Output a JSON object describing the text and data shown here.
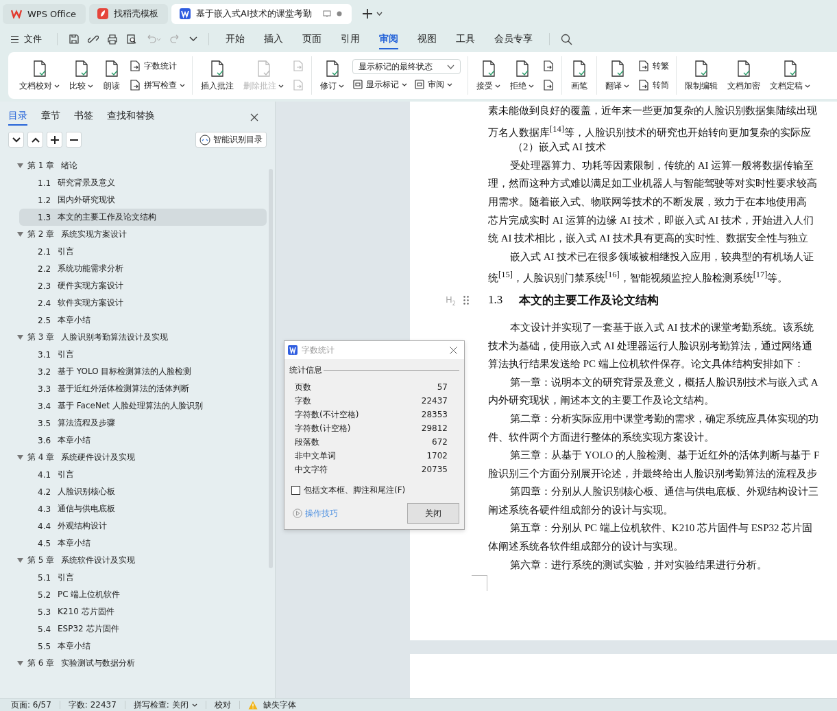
{
  "browser_tabs": [
    {
      "label": "WPS Office",
      "selected": false
    },
    {
      "label": "找稻壳模板",
      "selected": false
    },
    {
      "label": "基于嵌入式AI技术的课堂考勤",
      "selected": true
    }
  ],
  "menu": {
    "file": "文件",
    "tabs": [
      {
        "label": "开始",
        "selected": false
      },
      {
        "label": "插入",
        "selected": false
      },
      {
        "label": "页面",
        "selected": false
      },
      {
        "label": "引用",
        "selected": false
      },
      {
        "label": "审阅",
        "selected": true
      },
      {
        "label": "视图",
        "selected": false
      },
      {
        "label": "工具",
        "selected": false
      },
      {
        "label": "会员专享",
        "selected": false
      }
    ]
  },
  "ribbon": {
    "groups": [
      {
        "items": [
          {
            "kind": "large",
            "label": "文档校对",
            "caret": true,
            "disabled": false
          },
          {
            "kind": "large",
            "label": "比较",
            "caret": true,
            "disabled": false
          },
          {
            "kind": "large",
            "label": "朗读",
            "caret": false,
            "disabled": false
          },
          {
            "kind": "stack",
            "rows": [
              {
                "label": "字数统计",
                "caret": false,
                "disabled": false
              },
              {
                "label": "拼写检查",
                "caret": true,
                "disabled": false
              }
            ]
          }
        ]
      },
      {
        "items": [
          {
            "kind": "large",
            "label": "插入批注",
            "caret": false,
            "disabled": false
          },
          {
            "kind": "large",
            "label": "删除批注",
            "caret": true,
            "disabled": true
          },
          {
            "kind": "stack",
            "rows": [
              {
                "caret": false,
                "disabled": true
              },
              {
                "caret": false,
                "disabled": true
              }
            ]
          }
        ]
      },
      {
        "items": [
          {
            "kind": "large",
            "label": "修订",
            "caret": true,
            "disabled": false
          },
          {
            "kind": "combo",
            "value": "显示标记的最终状态",
            "buttons": [
              {
                "label": "显示标记",
                "caret": true
              },
              {
                "label": "审阅",
                "caret": true
              }
            ]
          }
        ]
      },
      {
        "items": [
          {
            "kind": "large",
            "label": "接受",
            "caret": true,
            "disabled": false
          },
          {
            "kind": "large",
            "label": "拒绝",
            "caret": true,
            "disabled": false
          },
          {
            "kind": "stack",
            "rows": [
              {
                "caret": false,
                "disabled": false
              },
              {
                "caret": false,
                "disabled": false
              }
            ]
          }
        ]
      },
      {
        "items": [
          {
            "kind": "large",
            "label": "画笔",
            "caret": false,
            "disabled": false
          }
        ]
      },
      {
        "items": [
          {
            "kind": "large",
            "label": "翻译",
            "caret": true,
            "disabled": false
          },
          {
            "kind": "stack",
            "rows": [
              {
                "label": "转繁",
                "caret": false,
                "disabled": false
              },
              {
                "label": "转简",
                "caret": false,
                "disabled": false
              }
            ]
          }
        ]
      },
      {
        "items": [
          {
            "kind": "large",
            "label": "限制编辑",
            "caret": false,
            "disabled": false
          },
          {
            "kind": "large",
            "label": "文档加密",
            "caret": false,
            "disabled": false
          },
          {
            "kind": "large",
            "label": "文档定稿",
            "caret": true,
            "disabled": false
          }
        ]
      }
    ]
  },
  "sidebar": {
    "tabs": [
      {
        "label": "目录",
        "selected": true
      },
      {
        "label": "章节",
        "selected": false
      },
      {
        "label": "书签",
        "selected": false
      },
      {
        "label": "查找和替换",
        "selected": false
      }
    ],
    "smart_button": "智能识别目录",
    "chapters": [
      {
        "number": "第 1 章",
        "title": "绪论",
        "expanded": true,
        "children": [
          {
            "number": "1.1",
            "title": "研究背景及意义",
            "selected": false
          },
          {
            "number": "1.2",
            "title": "国内外研究现状",
            "selected": false
          },
          {
            "number": "1.3",
            "title": "本文的主要工作及论文结构",
            "selected": true
          }
        ]
      },
      {
        "number": "第 2 章",
        "title": "系统实现方案设计",
        "expanded": true,
        "children": [
          {
            "number": "2.1",
            "title": "引言",
            "selected": false
          },
          {
            "number": "2.2",
            "title": "系统功能需求分析",
            "selected": false
          },
          {
            "number": "2.3",
            "title": "硬件实现方案设计",
            "selected": false
          },
          {
            "number": "2.4",
            "title": "软件实现方案设计",
            "selected": false
          },
          {
            "number": "2.5",
            "title": "本章小结",
            "selected": false
          }
        ]
      },
      {
        "number": "第 3 章",
        "title": "人脸识别考勤算法设计及实现",
        "expanded": true,
        "children": [
          {
            "number": "3.1",
            "title": "引言",
            "selected": false
          },
          {
            "number": "3.2",
            "title": "基于 YOLO 目标检测算法的人脸检测",
            "selected": false
          },
          {
            "number": "3.3",
            "title": "基于近红外活体检测算法的活体判断",
            "selected": false
          },
          {
            "number": "3.4",
            "title": "基于 FaceNet 人脸处理算法的人脸识别",
            "selected": false
          },
          {
            "number": "3.5",
            "title": "算法流程及步骤",
            "selected": false
          },
          {
            "number": "3.6",
            "title": "本章小结",
            "selected": false
          }
        ]
      },
      {
        "number": "第 4 章",
        "title": "系统硬件设计及实现",
        "expanded": true,
        "children": [
          {
            "number": "4.1",
            "title": "引言",
            "selected": false
          },
          {
            "number": "4.2",
            "title": "人脸识别核心板",
            "selected": false
          },
          {
            "number": "4.3",
            "title": "通信与供电底板",
            "selected": false
          },
          {
            "number": "4.4",
            "title": "外观结构设计",
            "selected": false
          },
          {
            "number": "4.5",
            "title": "本章小结",
            "selected": false
          }
        ]
      },
      {
        "number": "第 5 章",
        "title": "系统软件设计及实现",
        "expanded": true,
        "children": [
          {
            "number": "5.1",
            "title": "引言",
            "selected": false
          },
          {
            "number": "5.2",
            "title": "PC 端上位机软件",
            "selected": false
          },
          {
            "number": "5.3",
            "title": "K210 芯片固件",
            "selected": false
          },
          {
            "number": "5.4",
            "title": "ESP32 芯片固件",
            "selected": false
          },
          {
            "number": "5.5",
            "title": "本章小结",
            "selected": false
          }
        ]
      },
      {
        "number": "第 6 章",
        "title": "实验测试与数据分析",
        "expanded": true
      }
    ]
  },
  "document": {
    "blocks": [
      {
        "kind": "line",
        "indent": false,
        "text": "素未能做到良好的覆盖，近年来一些更加复杂的人脸识别数据集陆续出现"
      },
      {
        "kind": "line",
        "indent": false,
        "text": "万名人数据库$^{[14]}$等，人脸识别技术的研究也开始转向更加复杂的实际应"
      },
      {
        "kind": "sub",
        "indent": true,
        "text": "（2）嵌入式 AI 技术"
      },
      {
        "kind": "line",
        "indent": true,
        "text": "受处理器算力、功耗等因素限制，传统的 AI 运算一般将数据传输至"
      },
      {
        "kind": "line",
        "indent": false,
        "text": "理，然而这种方式难以满足如工业机器人与智能驾驶等对实时性要求较高"
      },
      {
        "kind": "line",
        "indent": false,
        "text": "用需求。随着嵌入式、物联网等技术的不断发展，致力于在本地使用高"
      },
      {
        "kind": "line",
        "indent": false,
        "text": "芯片完成实时 AI 运算的边缘 AI 技术，即嵌入式 AI 技术，开始进入人们"
      },
      {
        "kind": "line",
        "indent": false,
        "text": "统 AI 技术相比，嵌入式 AI 技术具有更高的实时性、数据安全性与独立"
      },
      {
        "kind": "line",
        "indent": true,
        "text": "嵌入式 AI 技术已在很多领域被相继投入应用，较典型的有机场人证"
      },
      {
        "kind": "line",
        "indent": false,
        "text": "统$^{[15]}$，人脸识别门禁系统$^{[16]}$，智能视频监控人脸检测系统$^{[17]}$等。"
      },
      {
        "kind": "heading",
        "marker": "H$_{2}$",
        "number": "1.3",
        "text": "本文的主要工作及论文结构"
      },
      {
        "kind": "line",
        "indent": true,
        "text": "本文设计并实现了一套基于嵌入式 AI 技术的课堂考勤系统。该系统"
      },
      {
        "kind": "line",
        "indent": false,
        "text": "技术为基础，使用嵌入式 AI 处理器运行人脸识别考勤算法，通过网络通"
      },
      {
        "kind": "line",
        "indent": false,
        "text": "算法执行结果发送给 PC 端上位机软件保存。论文具体结构安排如下："
      },
      {
        "kind": "line",
        "indent": true,
        "text": "第一章：说明本文的研究背景及意义，概括人脸识别技术与嵌入式 A"
      },
      {
        "kind": "line",
        "indent": false,
        "text": "内外研究现状，阐述本文的主要工作及论文结构。"
      },
      {
        "kind": "line",
        "indent": true,
        "text": "第二章：分析实际应用中课堂考勤的需求，确定系统应具体实现的功"
      },
      {
        "kind": "line",
        "indent": false,
        "text": "件、软件两个方面进行整体的系统实现方案设计。"
      },
      {
        "kind": "line",
        "indent": true,
        "text": "第三章：从基于 YOLO 的人脸检测、基于近红外的活体判断与基于 F"
      },
      {
        "kind": "line",
        "indent": false,
        "text": "脸识别三个方面分别展开论述，并最终给出人脸识别考勤算法的流程及步"
      },
      {
        "kind": "line",
        "indent": true,
        "text": "第四章：分别从人脸识别核心板、通信与供电底板、外观结构设计三"
      },
      {
        "kind": "line",
        "indent": false,
        "text": "阐述系统各硬件组成部分的设计与实现。"
      },
      {
        "kind": "line",
        "indent": true,
        "text": "第五章：分别从 PC 端上位机软件、K210 芯片固件与 ESP32 芯片固"
      },
      {
        "kind": "line",
        "indent": false,
        "text": "体阐述系统各软件组成部分的设计与实现。"
      },
      {
        "kind": "line",
        "indent": true,
        "text": "第六章：进行系统的测试实验，并对实验结果进行分析。"
      }
    ]
  },
  "dialog": {
    "title": "字数统计",
    "section": "统计信息",
    "rows": [
      {
        "label": "页数",
        "value": "57"
      },
      {
        "label": "字数",
        "value": "22437"
      },
      {
        "label": "字符数(不计空格)",
        "value": "28353"
      },
      {
        "label": "字符数(计空格)",
        "value": "29812"
      },
      {
        "label": "段落数",
        "value": "672"
      },
      {
        "label": "非中文单词",
        "value": "1702"
      },
      {
        "label": "中文字符",
        "value": "20735"
      }
    ],
    "checkbox": {
      "label": "包括文本框、脚注和尾注(F)",
      "checked": false
    },
    "tips_link": "操作技巧",
    "close_button": "关闭"
  },
  "status_bar": {
    "page": "页面: 6/57",
    "words": "字数: 22437",
    "spell": "拼写检查: 关闭",
    "proof": "校对",
    "missing_font": "缺失字体"
  }
}
